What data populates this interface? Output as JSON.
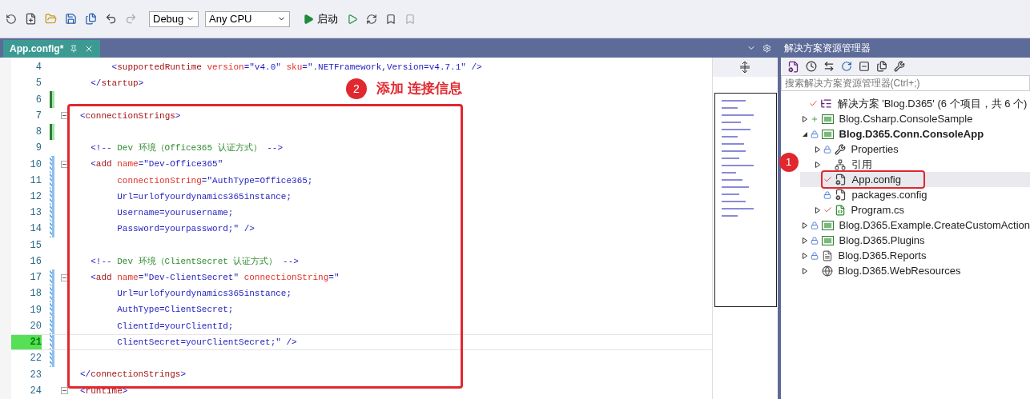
{
  "toolbar": {
    "configuration": "Debug",
    "platform": "Any CPU",
    "start_label": "启动"
  },
  "editor": {
    "tab": {
      "title": "App.config*",
      "selected": true
    },
    "lines": [
      {
        "number": "4",
        "saved": false,
        "modified": false,
        "fold": false,
        "current": false,
        "tokens": [
          {
            "kind": "delim",
            "t": "      <"
          },
          {
            "kind": "tag",
            "t": "supportedRuntime"
          },
          {
            "kind": "attr",
            "t": " version"
          },
          {
            "kind": "delim",
            "t": "=\"v4.0\""
          },
          {
            "kind": "attr",
            "t": " sku"
          },
          {
            "kind": "delim",
            "t": "=\".NETFramework,Version=v4.7.1\" />"
          }
        ]
      },
      {
        "number": "5",
        "saved": false,
        "modified": false,
        "fold": false,
        "current": false,
        "tokens": [
          {
            "kind": "delim",
            "t": "  </"
          },
          {
            "kind": "tag",
            "t": "startup"
          },
          {
            "kind": "delim",
            "t": ">"
          }
        ]
      },
      {
        "number": "6",
        "saved": true,
        "modified": false,
        "fold": false,
        "current": false
      },
      {
        "number": "7",
        "saved": false,
        "modified": false,
        "fold": true,
        "current": false,
        "tokens": [
          {
            "kind": "delim",
            "t": "<"
          },
          {
            "kind": "tag",
            "t": "connectionStrings"
          },
          {
            "kind": "delim",
            "t": ">"
          }
        ]
      },
      {
        "number": "8",
        "saved": true,
        "modified": false,
        "fold": false,
        "current": false
      },
      {
        "number": "9",
        "saved": false,
        "modified": false,
        "fold": false,
        "current": false,
        "tokens": [
          {
            "kind": "delim",
            "t": "  <!--"
          },
          {
            "kind": "comment",
            "t": " Dev 环境（Office365 认证方式） "
          },
          {
            "kind": "delim",
            "t": "-->"
          }
        ]
      },
      {
        "number": "10",
        "saved": false,
        "modified": true,
        "fold": true,
        "current": false,
        "tokens": [
          {
            "kind": "delim",
            "t": "  <"
          },
          {
            "kind": "tag",
            "t": "add"
          },
          {
            "kind": "attr",
            "t": " name"
          },
          {
            "kind": "delim",
            "t": "=\"Dev-Office365\""
          }
        ]
      },
      {
        "number": "11",
        "saved": false,
        "modified": true,
        "fold": false,
        "current": false,
        "tokens": [
          {
            "kind": "attr",
            "t": "       connectionString"
          },
          {
            "kind": "delim",
            "t": "=\"AuthType=Office365;"
          }
        ]
      },
      {
        "number": "12",
        "saved": false,
        "modified": true,
        "fold": false,
        "current": false,
        "tokens": [
          {
            "kind": "delim",
            "t": "       Url=urlofyourdynamics365instance;"
          }
        ]
      },
      {
        "number": "13",
        "saved": false,
        "modified": true,
        "fold": false,
        "current": false,
        "tokens": [
          {
            "kind": "delim",
            "t": "       Username=yourusername;"
          }
        ]
      },
      {
        "number": "14",
        "saved": false,
        "modified": true,
        "fold": false,
        "current": false,
        "tokens": [
          {
            "kind": "delim",
            "t": "       Password=yourpassword;\" />"
          }
        ]
      },
      {
        "number": "15",
        "saved": false,
        "modified": false,
        "fold": false,
        "current": false
      },
      {
        "number": "16",
        "saved": false,
        "modified": false,
        "fold": false,
        "current": false,
        "tokens": [
          {
            "kind": "delim",
            "t": "  <!--"
          },
          {
            "kind": "comment",
            "t": " Dev 环境（ClientSecret 认证方式） "
          },
          {
            "kind": "delim",
            "t": "-->"
          }
        ]
      },
      {
        "number": "17",
        "saved": false,
        "modified": true,
        "fold": true,
        "current": false,
        "tokens": [
          {
            "kind": "delim",
            "t": "  <"
          },
          {
            "kind": "tag",
            "t": "add"
          },
          {
            "kind": "attr",
            "t": " name"
          },
          {
            "kind": "delim",
            "t": "=\"Dev-ClientSecret\""
          },
          {
            "kind": "attr",
            "t": " connectionString"
          },
          {
            "kind": "delim",
            "t": "=\""
          }
        ]
      },
      {
        "number": "18",
        "saved": false,
        "modified": true,
        "fold": false,
        "current": false,
        "tokens": [
          {
            "kind": "delim",
            "t": "       Url=urlofyourdynamics365instance;"
          }
        ]
      },
      {
        "number": "19",
        "saved": false,
        "modified": true,
        "fold": false,
        "current": false,
        "tokens": [
          {
            "kind": "delim",
            "t": "       AuthType=ClientSecret;"
          }
        ]
      },
      {
        "number": "20",
        "saved": false,
        "modified": true,
        "fold": false,
        "current": false,
        "tokens": [
          {
            "kind": "delim",
            "t": "       ClientId=yourClientId;"
          }
        ]
      },
      {
        "number": "21",
        "saved": false,
        "modified": true,
        "fold": false,
        "current": true,
        "tokens": [
          {
            "kind": "delim",
            "t": "       ClientSecret=yourClientSecret;\" />"
          }
        ]
      },
      {
        "number": "22",
        "saved": false,
        "modified": true,
        "fold": false,
        "current": false
      },
      {
        "number": "23",
        "saved": false,
        "modified": false,
        "fold": false,
        "current": false,
        "tokens": [
          {
            "kind": "delim",
            "t": "</"
          },
          {
            "kind": "tag",
            "t": "connectionStrings"
          },
          {
            "kind": "delim",
            "t": ">"
          }
        ]
      },
      {
        "number": "24",
        "saved": false,
        "modified": false,
        "fold": true,
        "current": false,
        "tokens": [
          {
            "kind": "delim",
            "t": "<"
          },
          {
            "kind": "tag",
            "t": "runtime"
          },
          {
            "kind": "delim",
            "t": ">"
          }
        ]
      }
    ],
    "annotation": {
      "number": "2",
      "label": "添加 连接信息"
    }
  },
  "solution_explorer": {
    "title": "解决方案资源管理器",
    "search": {
      "placeholder": "搜索解决方案资源管理器(Ctrl+;)"
    },
    "annotation": {
      "number": "1"
    },
    "tree": [
      {
        "kind": "solution",
        "label": "解决方案 'Blog.D365' (6 个项目，共 6 个)",
        "checked": true,
        "locked": false,
        "added": false,
        "bold": false,
        "selected": false,
        "children": [
          {
            "kind": "project",
            "label": "Blog.Csharp.ConsoleSample",
            "checked": false,
            "locked": false,
            "added": true,
            "expanded": false,
            "bold": false,
            "selected": false
          },
          {
            "kind": "project",
            "label": "Blog.D365.Conn.ConsoleApp",
            "checked": false,
            "locked": true,
            "added": false,
            "expanded": true,
            "bold": true,
            "selected": false,
            "children": [
              {
                "kind": "properties",
                "label": "Properties",
                "checked": false,
                "locked": true,
                "added": false,
                "expanded": false,
                "bold": false,
                "selected": false
              },
              {
                "kind": "references",
                "label": "引用",
                "checked": false,
                "locked": false,
                "added": false,
                "expanded": false,
                "bold": false,
                "selected": false
              },
              {
                "kind": "config",
                "label": "App.config",
                "checked": true,
                "locked": false,
                "added": false,
                "bold": false,
                "selected": true
              },
              {
                "kind": "config",
                "label": "packages.config",
                "checked": false,
                "locked": true,
                "added": false,
                "bold": false,
                "selected": false
              },
              {
                "kind": "csharp",
                "label": "Program.cs",
                "checked": true,
                "locked": false,
                "added": false,
                "expanded": false,
                "bold": false,
                "selected": false
              }
            ]
          },
          {
            "kind": "project",
            "label": "Blog.D365.Example.CreateCustomAction",
            "checked": false,
            "locked": true,
            "added": false,
            "expanded": false,
            "bold": false,
            "selected": false
          },
          {
            "kind": "project",
            "label": "Blog.D365.Plugins",
            "checked": false,
            "locked": true,
            "added": false,
            "expanded": false,
            "bold": false,
            "selected": false
          },
          {
            "kind": "reports",
            "label": "Blog.D365.Reports",
            "checked": false,
            "locked": true,
            "added": false,
            "expanded": false,
            "bold": false,
            "selected": false
          },
          {
            "kind": "web",
            "label": "Blog.D365.WebResources",
            "checked": false,
            "locked": false,
            "added": false,
            "expanded": false,
            "bold": false,
            "selected": false
          }
        ]
      }
    ]
  }
}
